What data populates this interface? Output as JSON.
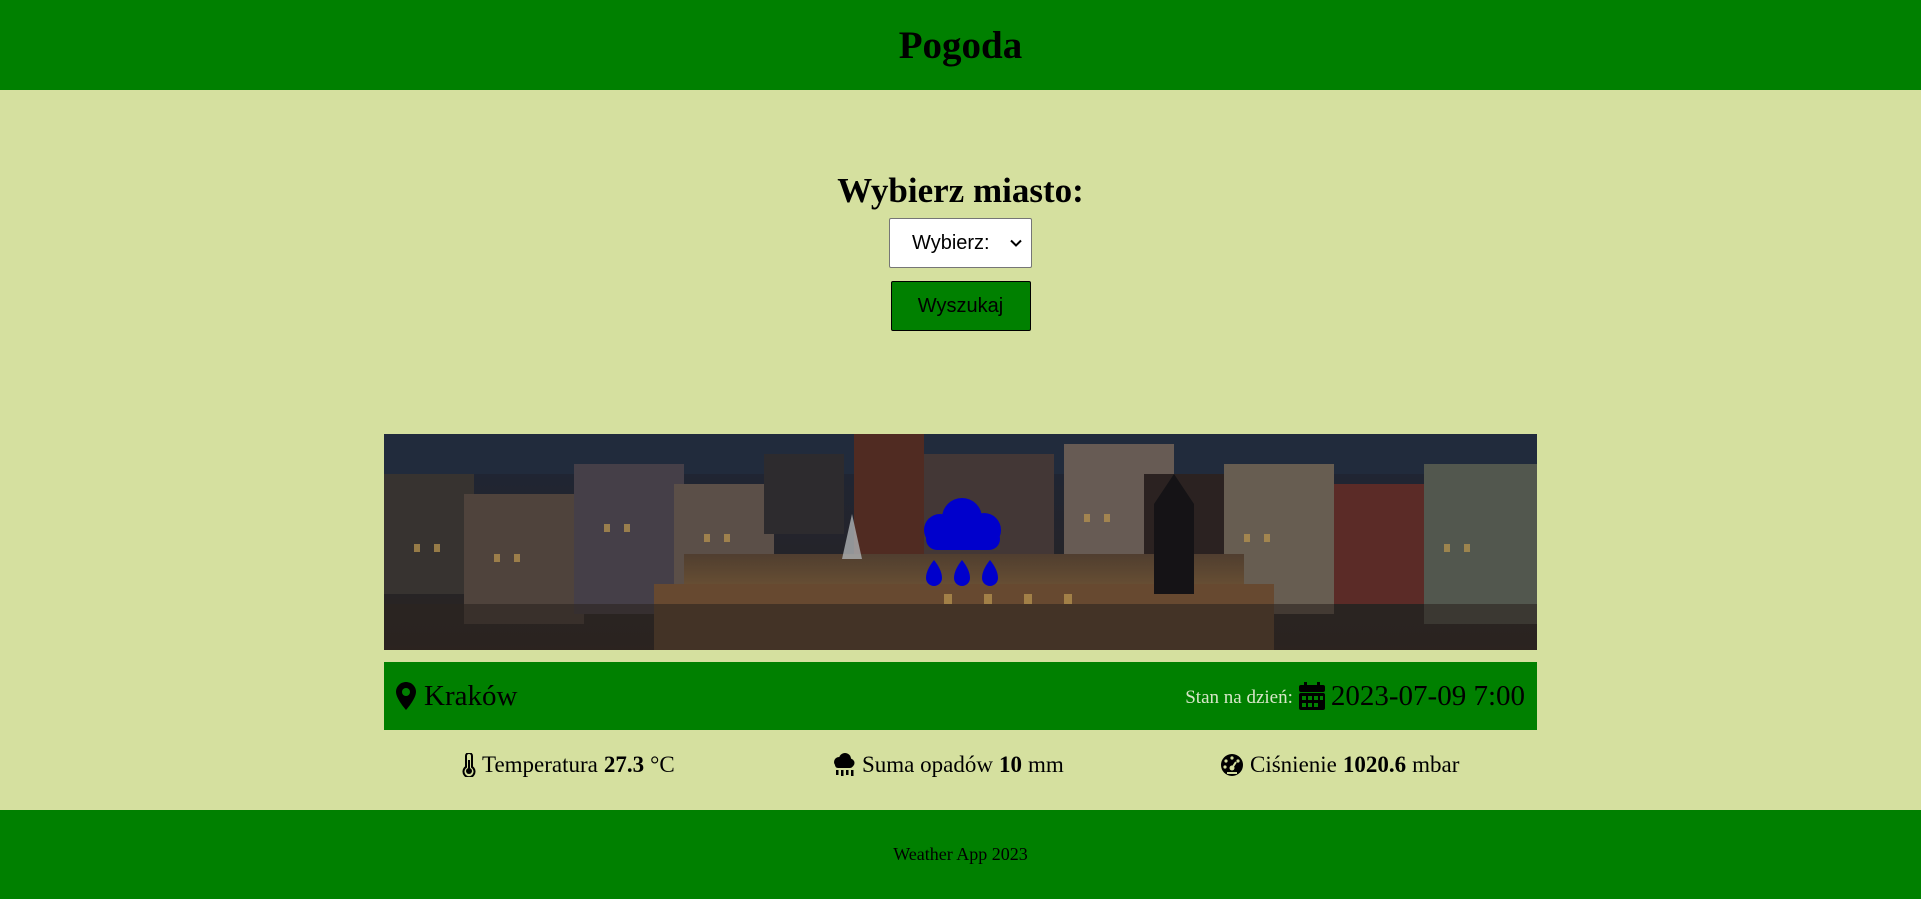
{
  "header": {
    "title": "Pogoda"
  },
  "search": {
    "heading": "Wybierz miasto:",
    "select_value": "Wybierz:",
    "button_label": "Wyszukaj"
  },
  "weather": {
    "icon": "cloud-rain-icon",
    "icon_color": "#0000cc",
    "city": "Kraków",
    "date_prefix": "Stan na dzień:",
    "date": "2023-07-09 7:00",
    "temperature": {
      "label": "Temperatura",
      "value": "27.3",
      "unit": "°C"
    },
    "precipitation": {
      "label": "Suma opadów",
      "value": "10",
      "unit": "mm"
    },
    "pressure": {
      "label": "Ciśnienie",
      "value": "1020.6",
      "unit": "mbar"
    }
  },
  "footer": {
    "text": "Weather App 2023"
  },
  "colors": {
    "primary_green": "#008000",
    "background": "#d5e09f"
  }
}
